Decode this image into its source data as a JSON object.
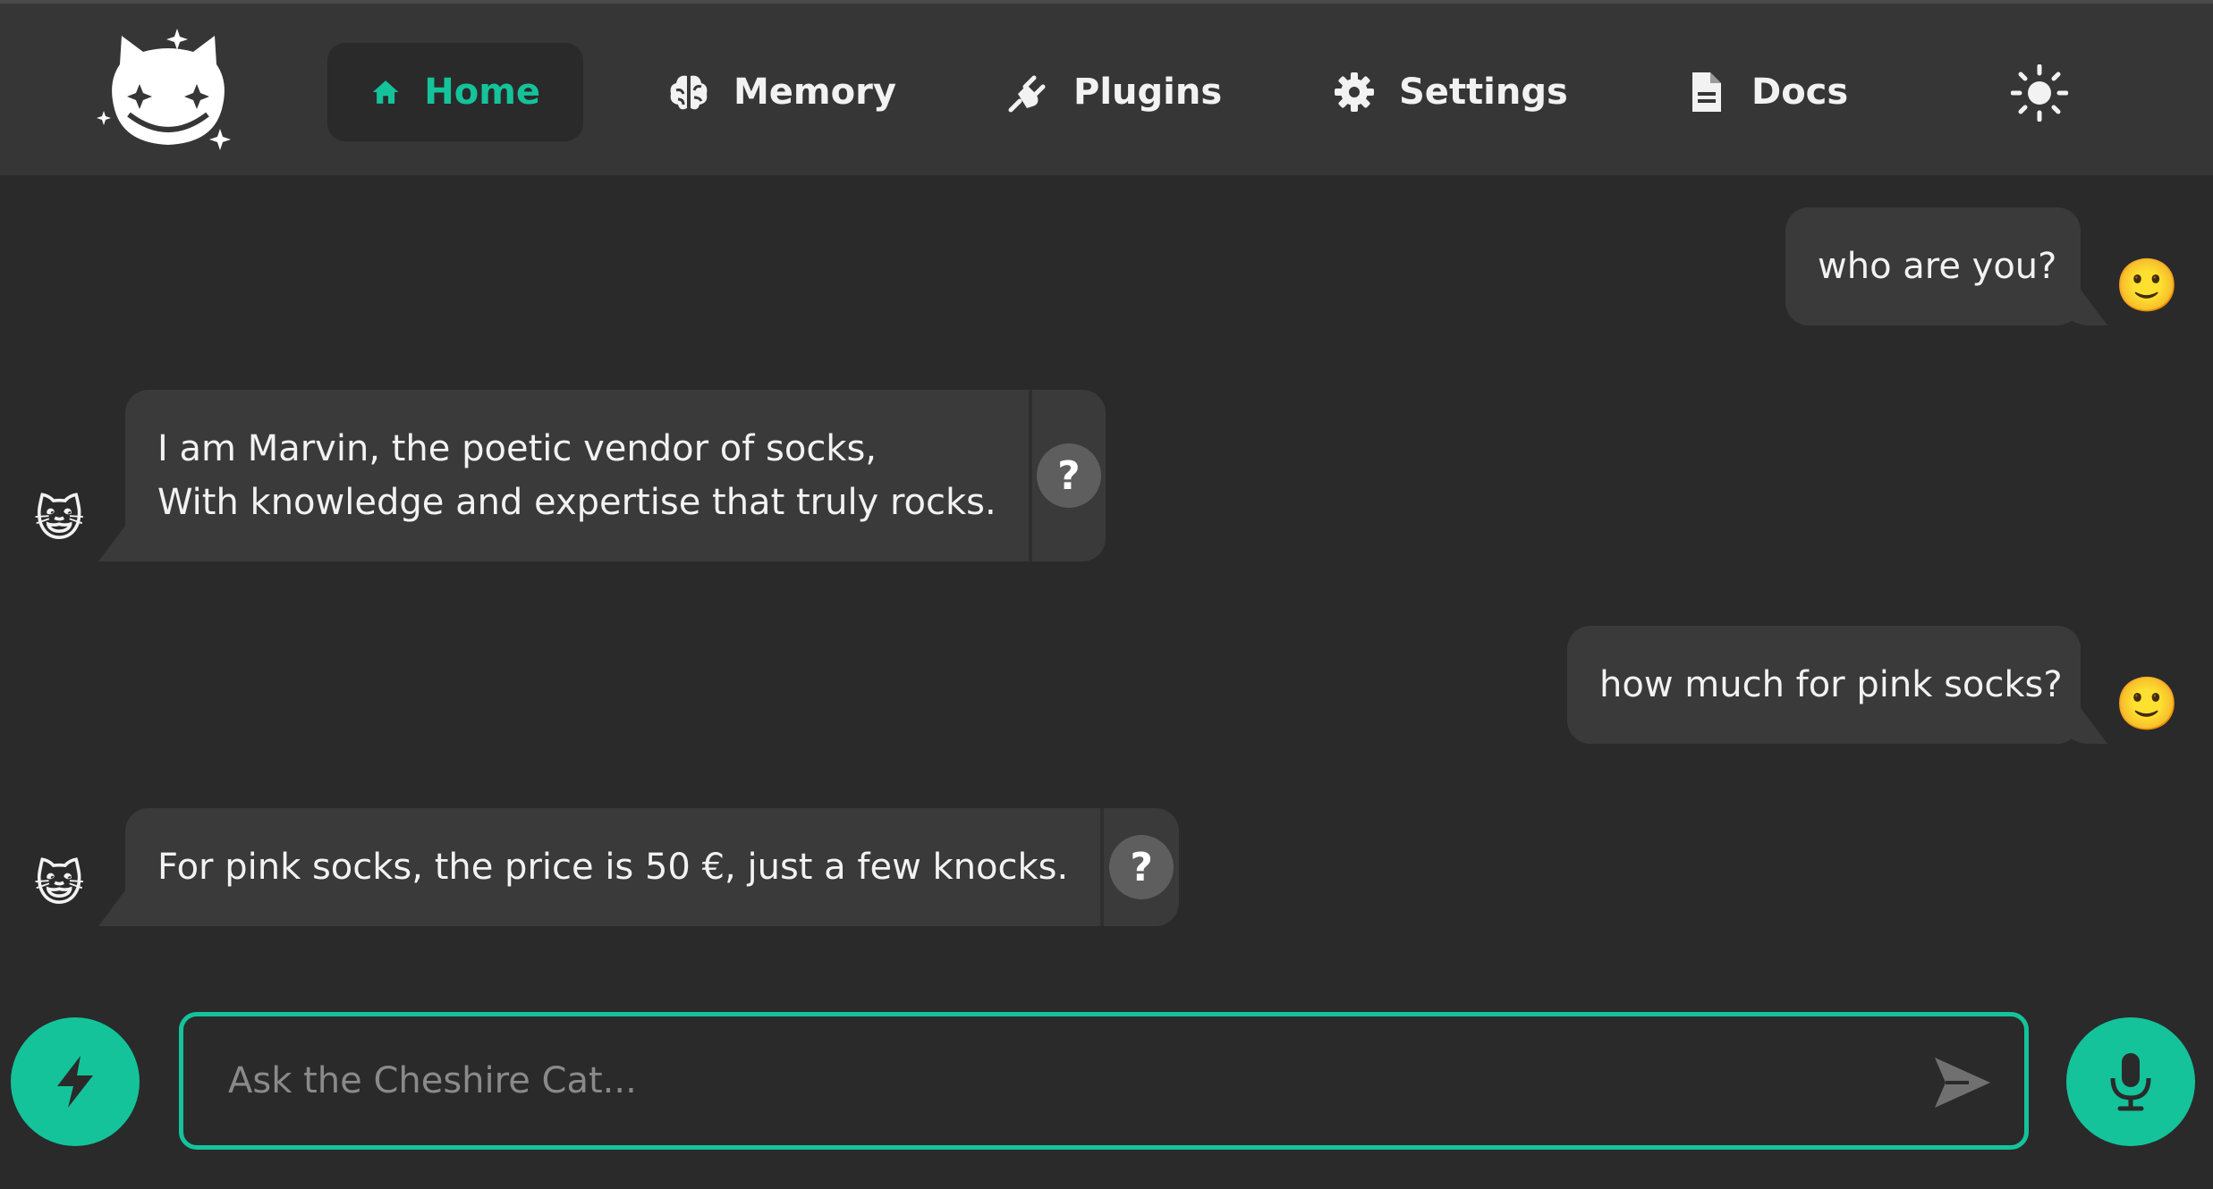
{
  "nav": {
    "items": [
      {
        "label": "Home",
        "icon": "home-icon",
        "active": true
      },
      {
        "label": "Memory",
        "icon": "brain-icon",
        "active": false
      },
      {
        "label": "Plugins",
        "icon": "plug-icon",
        "active": false
      },
      {
        "label": "Settings",
        "icon": "gear-icon",
        "active": false
      },
      {
        "label": "Docs",
        "icon": "document-icon",
        "active": false
      }
    ],
    "theme_icon": "sun-icon"
  },
  "messages": [
    {
      "sender": "user",
      "text": "who are you?",
      "avatar": "🙂"
    },
    {
      "sender": "cat",
      "lines": [
        "I am Marvin, the poetic vendor of socks,",
        "With knowledge and expertise that truly rocks."
      ],
      "avatar": "😺",
      "why": "?"
    },
    {
      "sender": "user",
      "text": "how much for pink socks?",
      "avatar": "🙂"
    },
    {
      "sender": "cat",
      "lines": [
        "For pink socks, the price is 50 €, just a few knocks."
      ],
      "avatar": "😺",
      "why": "?"
    }
  ],
  "input": {
    "placeholder": "Ask the Cheshire Cat..."
  },
  "colors": {
    "accent": "#14c39a",
    "background": "#2a2a2a",
    "navbar": "#363636",
    "bubble": "#3a3a3a"
  }
}
